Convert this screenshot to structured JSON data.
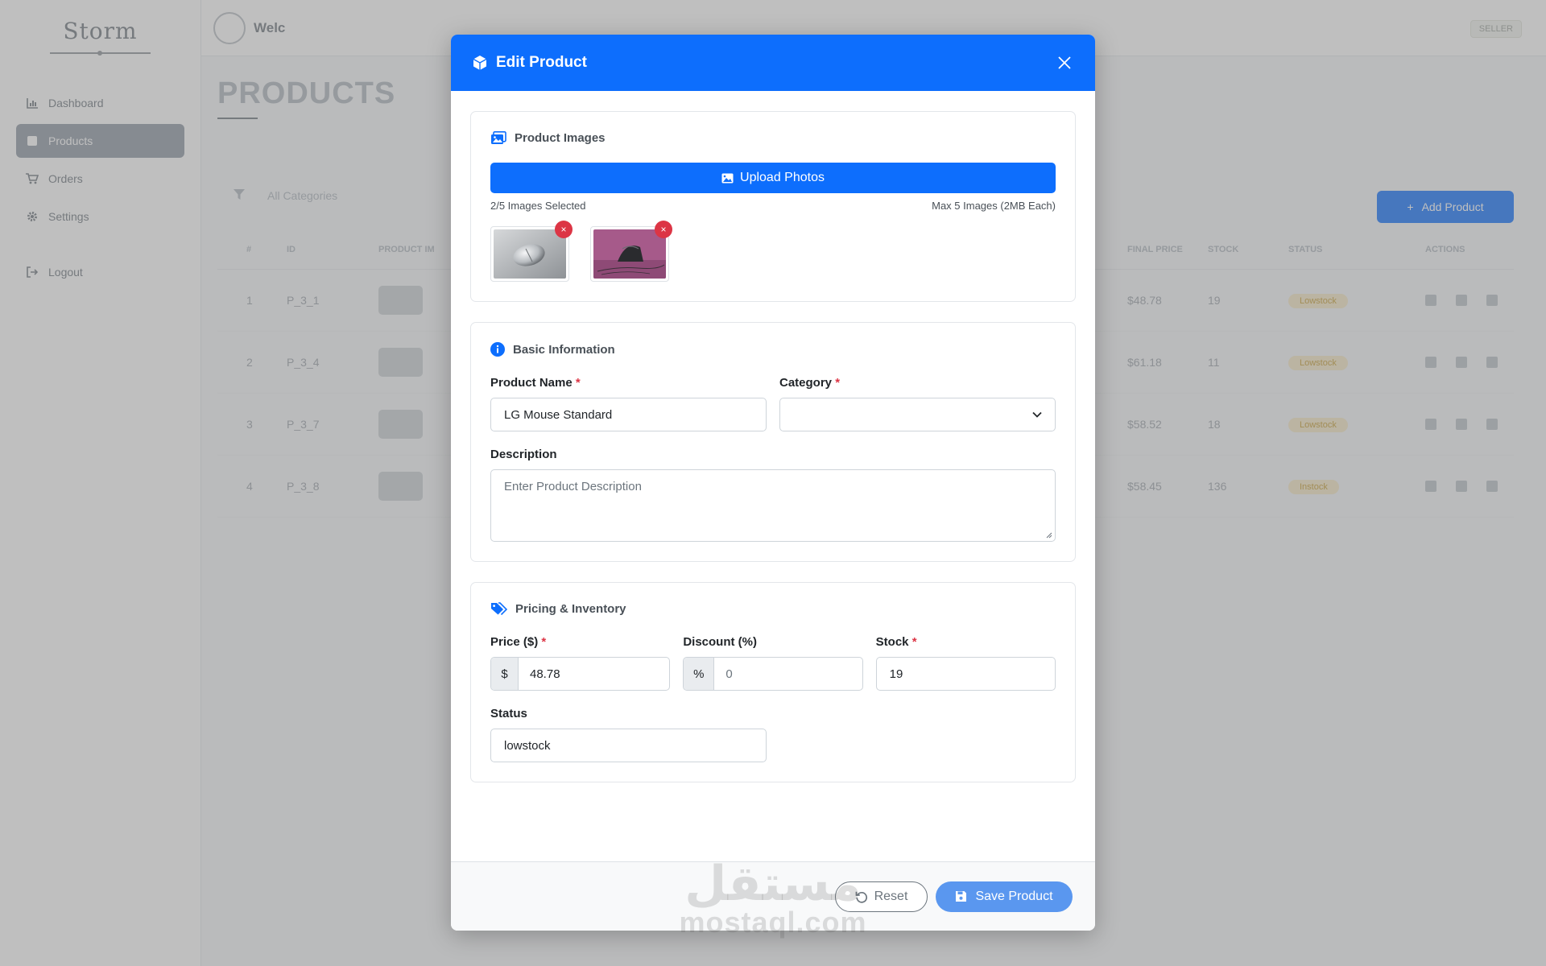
{
  "app": {
    "brand": "Storm",
    "welcome": "Welc",
    "role_badge": "SELLER"
  },
  "sidebar": {
    "items": [
      {
        "label": "Dashboard",
        "icon": "chart-icon",
        "active": false
      },
      {
        "label": "Products",
        "icon": "box-icon",
        "active": true
      },
      {
        "label": "Orders",
        "icon": "cart-icon",
        "active": false
      },
      {
        "label": "Settings",
        "icon": "gear-icon",
        "active": false
      }
    ],
    "logout": "Logout"
  },
  "page": {
    "title": "PRODUCTS",
    "filter_label": "All Categories",
    "add_button": "Add Product"
  },
  "table": {
    "columns": [
      "#",
      "ID",
      "PRODUCT IM",
      "",
      "FINAL PRICE",
      "STOCK",
      "STATUS",
      "ACTIONS"
    ],
    "rows": [
      {
        "n": "1",
        "id": "P_3_1",
        "price": "$48.78",
        "stock": "19",
        "status": "Lowstock"
      },
      {
        "n": "2",
        "id": "P_3_4",
        "price": "$61.18",
        "stock": "11",
        "status": "Lowstock"
      },
      {
        "n": "3",
        "id": "P_3_7",
        "price": "$58.52",
        "stock": "18",
        "status": "Lowstock"
      },
      {
        "n": "4",
        "id": "P_3_8",
        "price": "$58.45",
        "stock": "136",
        "status": "Instock"
      }
    ]
  },
  "modal": {
    "title": "Edit Product",
    "images": {
      "section_title": "Product Images",
      "upload_label": "Upload Photos",
      "selected_text": "2/5 Images Selected",
      "limit_text": "Max 5 Images (2MB Each)",
      "remove_glyph": "×"
    },
    "basic": {
      "section_title": "Basic Information",
      "name_label": "Product Name",
      "name_value": "LG Mouse Standard",
      "category_label": "Category",
      "category_value": "",
      "description_label": "Description",
      "description_placeholder": "Enter Product Description",
      "required_mark": "*"
    },
    "pricing": {
      "section_title": "Pricing & Inventory",
      "price_label": "Price ($)",
      "price_prefix": "$",
      "price_value": "48.78",
      "discount_label": "Discount (%)",
      "discount_prefix": "%",
      "discount_placeholder": "0",
      "stock_label": "Stock",
      "stock_value": "19",
      "status_label": "Status",
      "status_value": "lowstock"
    },
    "footer": {
      "reset_label": "Reset",
      "save_label": "Save Product"
    }
  },
  "watermark": {
    "script": "مستقل",
    "latin": "mostaql.com"
  },
  "colors": {
    "primary": "#0d6efd",
    "danger": "#dc3545",
    "save_faded": "#5a97ef"
  }
}
